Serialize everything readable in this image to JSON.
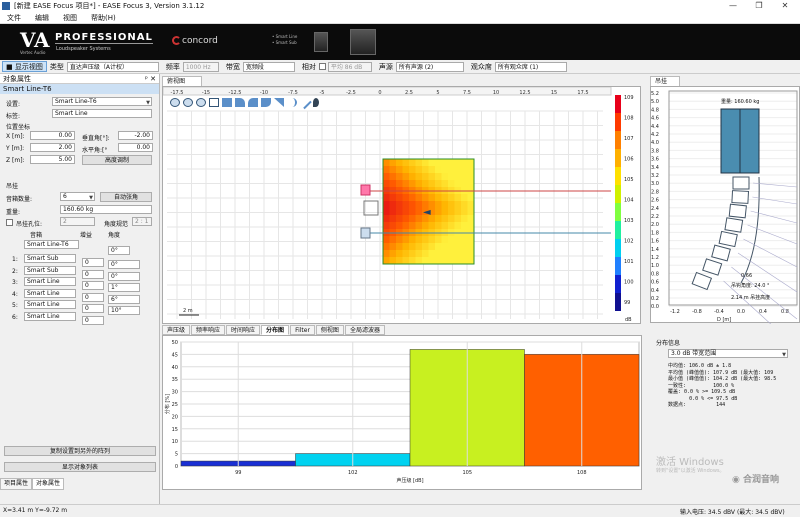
{
  "window": {
    "title": "[新建 EASE Focus 项目*] - EASE Focus 3, Version 3.1.12"
  },
  "menu": [
    "文件",
    "编辑",
    "视图",
    "帮助(H)"
  ],
  "banner": {
    "va": "VA",
    "va_sub": "Vertec Audio",
    "professional": "PROFESSIONAL",
    "pro_sub": "Loudspeaker Systems",
    "concord": "concord",
    "smart_line": "• Smart Line",
    "smart_sub": "• Smart Sub"
  },
  "toolbar": {
    "show_view": "显示视图",
    "type_label": "类型",
    "type_value": "直达声压级（A计权）",
    "freq_label": "频率",
    "freq_value": "1000 Hz",
    "band_label": "带宽",
    "band_value": "宽频段",
    "relative_label": "相对",
    "avg_value": "平均 86 dB",
    "source_label": "声源",
    "source_value": "所有声源 (2)",
    "audience_label": "观众席",
    "audience_value": "所有观众席 (1)"
  },
  "left_panel": {
    "header": "对象属性",
    "tree_item": "Smart Line-T6",
    "settings_label": "设置:",
    "settings_value": "Smart Line-T6",
    "name_label": "标签:",
    "name_value": "Smart Line",
    "position_label": "位置坐标",
    "x_label": "X [m]:",
    "x_value": "0.00",
    "y_label": "Y [m]:",
    "y_value": "2.00",
    "z_label": "Z [m]:",
    "z_value": "5.00",
    "vert_label": "垂直角[°]:",
    "vert_value": "-2.00",
    "horiz_label": "水平角:[°",
    "horiz_value": "0.00",
    "height_btn": "高度调制",
    "hang_label": "吊挂",
    "box_count_label": "音箱数量:",
    "box_count_value": "6",
    "auto_angle_btn": "自动张角",
    "weight_label": "重量:",
    "weight_value": "160.60 kg",
    "hang_hole_label": "吊挂孔位:",
    "hang_hole_value": "2",
    "angle_rule_label": "角度规范",
    "angle_rule_value": "2 : 1",
    "table_headers": [
      "音箱",
      "增益",
      "角度"
    ],
    "rig_top": "Smart Line-T6",
    "rig_top_angle": "0°",
    "rows": [
      {
        "n": "1:",
        "box": "Smart Sub",
        "gain": "0",
        "angle": "0°"
      },
      {
        "n": "2:",
        "box": "Smart Sub",
        "gain": "0",
        "angle": "0°"
      },
      {
        "n": "3:",
        "box": "Smart Line",
        "gain": "0",
        "angle": "1°"
      },
      {
        "n": "4:",
        "box": "Smart Line",
        "gain": "0",
        "angle": "6°"
      },
      {
        "n": "5:",
        "box": "Smart Line",
        "gain": "0",
        "angle": "10°"
      },
      {
        "n": "6:",
        "box": "Smart Line",
        "gain": "0",
        "angle": ""
      }
    ],
    "copy_btn": "复制设置到另外的阵列",
    "show_list_btn": "显示对象列表",
    "tab_project": "项目属性",
    "tab_object": "对象属性"
  },
  "view": {
    "tab": "俯视图",
    "x_ticks": [
      "-17.5",
      "-15",
      "-12.5",
      "-10",
      "-7.5",
      "-5",
      "-2.5",
      "0",
      "2.5",
      "5",
      "7.5",
      "10",
      "12.5",
      "15",
      "17.5"
    ],
    "scale_label": "2 m",
    "colorbar_ticks": [
      "109",
      "108",
      "107",
      "106",
      "105",
      "104",
      "103",
      "102",
      "101",
      "100",
      "99"
    ],
    "colorbar_unit": "dB"
  },
  "right_view": {
    "tab": "吊挂",
    "y_ticks": [
      "5.2",
      "5.0",
      "4.8",
      "4.6",
      "4.4",
      "4.2",
      "4.0",
      "3.8",
      "3.6",
      "3.4",
      "3.2",
      "3.0",
      "2.8",
      "2.6",
      "2.4",
      "2.2",
      "2.0",
      "1.8",
      "1.6",
      "1.4",
      "1.2",
      "1.0",
      "0.8",
      "0.6",
      "0.4",
      "0.2",
      "0.0"
    ],
    "x_ticks": [
      "-1.2",
      "-0.8",
      "-0.4",
      "0.0",
      "0.4",
      "0.8"
    ],
    "x_unit": "D [m]",
    "weight_text": "重量: 160.60 kg",
    "width_text": "0.66",
    "angle_text": "吊钩角度: 24.0 °",
    "height_text": "2.14 m 吊挂高度"
  },
  "bottom_tabs": [
    "声压级",
    "频率响应",
    "时间响应",
    "分布图",
    "Filter",
    "侧视图",
    "全局滤波器"
  ],
  "bottom_active": "分布图",
  "chart_data": {
    "type": "bar",
    "categories": [
      "99",
      "102",
      "105",
      "108"
    ],
    "values": [
      2,
      5,
      47,
      45
    ],
    "colors": [
      "#1a2fd4",
      "#00d2f0",
      "#c8f020",
      "#ff6000"
    ],
    "ylabel": "分布 [%]",
    "xlabel": "声压级 [dB]",
    "ylim": [
      0,
      50
    ],
    "yticks": [
      "0",
      "5",
      "10",
      "15",
      "20",
      "25",
      "30",
      "35",
      "40",
      "45",
      "50"
    ],
    "grid": true
  },
  "stats": {
    "header": "分布信息",
    "select": "3.0 dB 带宽范围",
    "lines": [
      "中均值: 106.0 dB ± 1.8",
      "平均值 (峰值值): 107.9 dB (最大值: 109",
      "最小值 (峰值值): 104.2 dB (最大值: 98.5",
      "一致性:         100.0 %",
      "覆盖: 0.0 % >= 109.5 dB",
      "       0.0 % <= 97.5 dB",
      "数据点:          144"
    ],
    "watermark": "激活 Windows",
    "watermark_sub": "转到\"设置\"以激活 Windows。"
  },
  "status": {
    "coords": "X=3.41 m Y=-9.72 m",
    "voltage": "输入电压: 34.5 dBV (最大: 34.5 dBV)"
  },
  "wechat": "合润音响"
}
